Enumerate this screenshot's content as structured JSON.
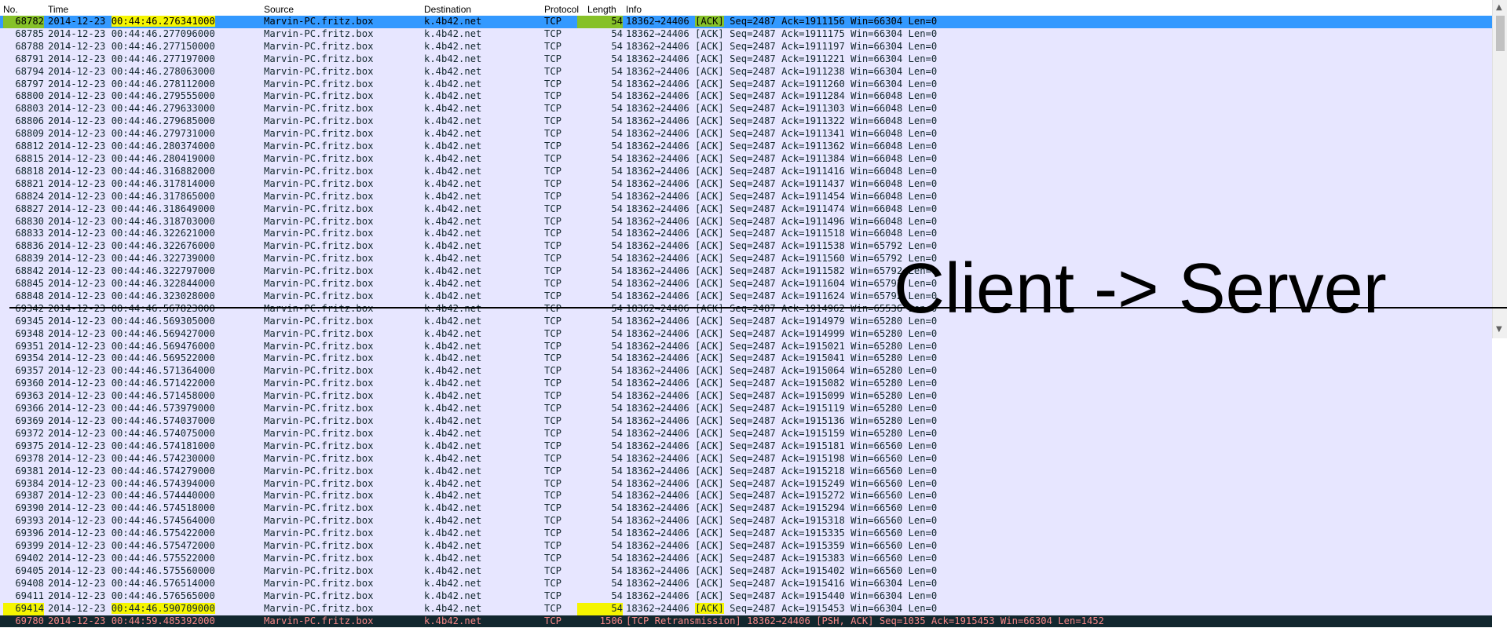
{
  "columns": {
    "no": "No.",
    "time": "Time",
    "source": "Source",
    "destination": "Destination",
    "protocol": "Protocol",
    "length": "Length",
    "info": "Info"
  },
  "annotation": "Client -> Server",
  "colors": {
    "row_bg": "#e7e6ff",
    "selected_bg": "#3399ff",
    "highlight_green": "#86c128",
    "highlight_yellow": "#f5f500",
    "retransmission_bg": "#12272e",
    "retransmission_fg": "#f78787"
  },
  "packets": [
    {
      "no": "68782",
      "time": "2014-12-23 00:44:46.276341000",
      "source": "Marvin-PC.fritz.box",
      "destination": "k.4b42.net",
      "protocol": "TCP",
      "length": "54",
      "info": "18362→24406 [ACK] Seq=2487 Ack=1911156 Win=66304 Len=0"
    },
    {
      "no": "68785",
      "time": "2014-12-23 00:44:46.277096000",
      "source": "Marvin-PC.fritz.box",
      "destination": "k.4b42.net",
      "protocol": "TCP",
      "length": "54",
      "info": "18362→24406 [ACK] Seq=2487 Ack=1911175 Win=66304 Len=0"
    },
    {
      "no": "68788",
      "time": "2014-12-23 00:44:46.277150000",
      "source": "Marvin-PC.fritz.box",
      "destination": "k.4b42.net",
      "protocol": "TCP",
      "length": "54",
      "info": "18362→24406 [ACK] Seq=2487 Ack=1911197 Win=66304 Len=0"
    },
    {
      "no": "68791",
      "time": "2014-12-23 00:44:46.277197000",
      "source": "Marvin-PC.fritz.box",
      "destination": "k.4b42.net",
      "protocol": "TCP",
      "length": "54",
      "info": "18362→24406 [ACK] Seq=2487 Ack=1911221 Win=66304 Len=0"
    },
    {
      "no": "68794",
      "time": "2014-12-23 00:44:46.278063000",
      "source": "Marvin-PC.fritz.box",
      "destination": "k.4b42.net",
      "protocol": "TCP",
      "length": "54",
      "info": "18362→24406 [ACK] Seq=2487 Ack=1911238 Win=66304 Len=0"
    },
    {
      "no": "68797",
      "time": "2014-12-23 00:44:46.278112000",
      "source": "Marvin-PC.fritz.box",
      "destination": "k.4b42.net",
      "protocol": "TCP",
      "length": "54",
      "info": "18362→24406 [ACK] Seq=2487 Ack=1911260 Win=66304 Len=0"
    },
    {
      "no": "68800",
      "time": "2014-12-23 00:44:46.279555000",
      "source": "Marvin-PC.fritz.box",
      "destination": "k.4b42.net",
      "protocol": "TCP",
      "length": "54",
      "info": "18362→24406 [ACK] Seq=2487 Ack=1911284 Win=66048 Len=0"
    },
    {
      "no": "68803",
      "time": "2014-12-23 00:44:46.279633000",
      "source": "Marvin-PC.fritz.box",
      "destination": "k.4b42.net",
      "protocol": "TCP",
      "length": "54",
      "info": "18362→24406 [ACK] Seq=2487 Ack=1911303 Win=66048 Len=0"
    },
    {
      "no": "68806",
      "time": "2014-12-23 00:44:46.279685000",
      "source": "Marvin-PC.fritz.box",
      "destination": "k.4b42.net",
      "protocol": "TCP",
      "length": "54",
      "info": "18362→24406 [ACK] Seq=2487 Ack=1911322 Win=66048 Len=0"
    },
    {
      "no": "68809",
      "time": "2014-12-23 00:44:46.279731000",
      "source": "Marvin-PC.fritz.box",
      "destination": "k.4b42.net",
      "protocol": "TCP",
      "length": "54",
      "info": "18362→24406 [ACK] Seq=2487 Ack=1911341 Win=66048 Len=0"
    },
    {
      "no": "68812",
      "time": "2014-12-23 00:44:46.280374000",
      "source": "Marvin-PC.fritz.box",
      "destination": "k.4b42.net",
      "protocol": "TCP",
      "length": "54",
      "info": "18362→24406 [ACK] Seq=2487 Ack=1911362 Win=66048 Len=0"
    },
    {
      "no": "68815",
      "time": "2014-12-23 00:44:46.280419000",
      "source": "Marvin-PC.fritz.box",
      "destination": "k.4b42.net",
      "protocol": "TCP",
      "length": "54",
      "info": "18362→24406 [ACK] Seq=2487 Ack=1911384 Win=66048 Len=0"
    },
    {
      "no": "68818",
      "time": "2014-12-23 00:44:46.316882000",
      "source": "Marvin-PC.fritz.box",
      "destination": "k.4b42.net",
      "protocol": "TCP",
      "length": "54",
      "info": "18362→24406 [ACK] Seq=2487 Ack=1911416 Win=66048 Len=0"
    },
    {
      "no": "68821",
      "time": "2014-12-23 00:44:46.317814000",
      "source": "Marvin-PC.fritz.box",
      "destination": "k.4b42.net",
      "protocol": "TCP",
      "length": "54",
      "info": "18362→24406 [ACK] Seq=2487 Ack=1911437 Win=66048 Len=0"
    },
    {
      "no": "68824",
      "time": "2014-12-23 00:44:46.317865000",
      "source": "Marvin-PC.fritz.box",
      "destination": "k.4b42.net",
      "protocol": "TCP",
      "length": "54",
      "info": "18362→24406 [ACK] Seq=2487 Ack=1911454 Win=66048 Len=0"
    },
    {
      "no": "68827",
      "time": "2014-12-23 00:44:46.318649000",
      "source": "Marvin-PC.fritz.box",
      "destination": "k.4b42.net",
      "protocol": "TCP",
      "length": "54",
      "info": "18362→24406 [ACK] Seq=2487 Ack=1911474 Win=66048 Len=0"
    },
    {
      "no": "68830",
      "time": "2014-12-23 00:44:46.318703000",
      "source": "Marvin-PC.fritz.box",
      "destination": "k.4b42.net",
      "protocol": "TCP",
      "length": "54",
      "info": "18362→24406 [ACK] Seq=2487 Ack=1911496 Win=66048 Len=0"
    },
    {
      "no": "68833",
      "time": "2014-12-23 00:44:46.322621000",
      "source": "Marvin-PC.fritz.box",
      "destination": "k.4b42.net",
      "protocol": "TCP",
      "length": "54",
      "info": "18362→24406 [ACK] Seq=2487 Ack=1911518 Win=66048 Len=0"
    },
    {
      "no": "68836",
      "time": "2014-12-23 00:44:46.322676000",
      "source": "Marvin-PC.fritz.box",
      "destination": "k.4b42.net",
      "protocol": "TCP",
      "length": "54",
      "info": "18362→24406 [ACK] Seq=2487 Ack=1911538 Win=65792 Len=0"
    },
    {
      "no": "68839",
      "time": "2014-12-23 00:44:46.322739000",
      "source": "Marvin-PC.fritz.box",
      "destination": "k.4b42.net",
      "protocol": "TCP",
      "length": "54",
      "info": "18362→24406 [ACK] Seq=2487 Ack=1911560 Win=65792 Len=0"
    },
    {
      "no": "68842",
      "time": "2014-12-23 00:44:46.322797000",
      "source": "Marvin-PC.fritz.box",
      "destination": "k.4b42.net",
      "protocol": "TCP",
      "length": "54",
      "info": "18362→24406 [ACK] Seq=2487 Ack=1911582 Win=65792 Len=0"
    },
    {
      "no": "68845",
      "time": "2014-12-23 00:44:46.322844000",
      "source": "Marvin-PC.fritz.box",
      "destination": "k.4b42.net",
      "protocol": "TCP",
      "length": "54",
      "info": "18362→24406 [ACK] Seq=2487 Ack=1911604 Win=65792 Len=0"
    },
    {
      "no": "68848",
      "time": "2014-12-23 00:44:46.323028000",
      "source": "Marvin-PC.fritz.box",
      "destination": "k.4b42.net",
      "protocol": "TCP",
      "length": "54",
      "info": "18362→24406 [ACK] Seq=2487 Ack=1911624 Win=65792 Len=0"
    },
    {
      "no": "69342",
      "time": "2014-12-23 00:44:46.567823000",
      "source": "Marvin-PC.fritz.box",
      "destination": "k.4b42.net",
      "protocol": "TCP",
      "length": "54",
      "info": "18362→24406 [ACK] Seq=2487 Ack=1914962 Win=65536 Len=0"
    },
    {
      "no": "69345",
      "time": "2014-12-23 00:44:46.569305000",
      "source": "Marvin-PC.fritz.box",
      "destination": "k.4b42.net",
      "protocol": "TCP",
      "length": "54",
      "info": "18362→24406 [ACK] Seq=2487 Ack=1914979 Win=65280 Len=0"
    },
    {
      "no": "69348",
      "time": "2014-12-23 00:44:46.569427000",
      "source": "Marvin-PC.fritz.box",
      "destination": "k.4b42.net",
      "protocol": "TCP",
      "length": "54",
      "info": "18362→24406 [ACK] Seq=2487 Ack=1914999 Win=65280 Len=0"
    },
    {
      "no": "69351",
      "time": "2014-12-23 00:44:46.569476000",
      "source": "Marvin-PC.fritz.box",
      "destination": "k.4b42.net",
      "protocol": "TCP",
      "length": "54",
      "info": "18362→24406 [ACK] Seq=2487 Ack=1915021 Win=65280 Len=0"
    },
    {
      "no": "69354",
      "time": "2014-12-23 00:44:46.569522000",
      "source": "Marvin-PC.fritz.box",
      "destination": "k.4b42.net",
      "protocol": "TCP",
      "length": "54",
      "info": "18362→24406 [ACK] Seq=2487 Ack=1915041 Win=65280 Len=0"
    },
    {
      "no": "69357",
      "time": "2014-12-23 00:44:46.571364000",
      "source": "Marvin-PC.fritz.box",
      "destination": "k.4b42.net",
      "protocol": "TCP",
      "length": "54",
      "info": "18362→24406 [ACK] Seq=2487 Ack=1915064 Win=65280 Len=0"
    },
    {
      "no": "69360",
      "time": "2014-12-23 00:44:46.571422000",
      "source": "Marvin-PC.fritz.box",
      "destination": "k.4b42.net",
      "protocol": "TCP",
      "length": "54",
      "info": "18362→24406 [ACK] Seq=2487 Ack=1915082 Win=65280 Len=0"
    },
    {
      "no": "69363",
      "time": "2014-12-23 00:44:46.571458000",
      "source": "Marvin-PC.fritz.box",
      "destination": "k.4b42.net",
      "protocol": "TCP",
      "length": "54",
      "info": "18362→24406 [ACK] Seq=2487 Ack=1915099 Win=65280 Len=0"
    },
    {
      "no": "69366",
      "time": "2014-12-23 00:44:46.573979000",
      "source": "Marvin-PC.fritz.box",
      "destination": "k.4b42.net",
      "protocol": "TCP",
      "length": "54",
      "info": "18362→24406 [ACK] Seq=2487 Ack=1915119 Win=65280 Len=0"
    },
    {
      "no": "69369",
      "time": "2014-12-23 00:44:46.574037000",
      "source": "Marvin-PC.fritz.box",
      "destination": "k.4b42.net",
      "protocol": "TCP",
      "length": "54",
      "info": "18362→24406 [ACK] Seq=2487 Ack=1915136 Win=65280 Len=0"
    },
    {
      "no": "69372",
      "time": "2014-12-23 00:44:46.574075000",
      "source": "Marvin-PC.fritz.box",
      "destination": "k.4b42.net",
      "protocol": "TCP",
      "length": "54",
      "info": "18362→24406 [ACK] Seq=2487 Ack=1915159 Win=65280 Len=0"
    },
    {
      "no": "69375",
      "time": "2014-12-23 00:44:46.574181000",
      "source": "Marvin-PC.fritz.box",
      "destination": "k.4b42.net",
      "protocol": "TCP",
      "length": "54",
      "info": "18362→24406 [ACK] Seq=2487 Ack=1915181 Win=66560 Len=0"
    },
    {
      "no": "69378",
      "time": "2014-12-23 00:44:46.574230000",
      "source": "Marvin-PC.fritz.box",
      "destination": "k.4b42.net",
      "protocol": "TCP",
      "length": "54",
      "info": "18362→24406 [ACK] Seq=2487 Ack=1915198 Win=66560 Len=0"
    },
    {
      "no": "69381",
      "time": "2014-12-23 00:44:46.574279000",
      "source": "Marvin-PC.fritz.box",
      "destination": "k.4b42.net",
      "protocol": "TCP",
      "length": "54",
      "info": "18362→24406 [ACK] Seq=2487 Ack=1915218 Win=66560 Len=0"
    },
    {
      "no": "69384",
      "time": "2014-12-23 00:44:46.574394000",
      "source": "Marvin-PC.fritz.box",
      "destination": "k.4b42.net",
      "protocol": "TCP",
      "length": "54",
      "info": "18362→24406 [ACK] Seq=2487 Ack=1915249 Win=66560 Len=0"
    },
    {
      "no": "69387",
      "time": "2014-12-23 00:44:46.574440000",
      "source": "Marvin-PC.fritz.box",
      "destination": "k.4b42.net",
      "protocol": "TCP",
      "length": "54",
      "info": "18362→24406 [ACK] Seq=2487 Ack=1915272 Win=66560 Len=0"
    },
    {
      "no": "69390",
      "time": "2014-12-23 00:44:46.574518000",
      "source": "Marvin-PC.fritz.box",
      "destination": "k.4b42.net",
      "protocol": "TCP",
      "length": "54",
      "info": "18362→24406 [ACK] Seq=2487 Ack=1915294 Win=66560 Len=0"
    },
    {
      "no": "69393",
      "time": "2014-12-23 00:44:46.574564000",
      "source": "Marvin-PC.fritz.box",
      "destination": "k.4b42.net",
      "protocol": "TCP",
      "length": "54",
      "info": "18362→24406 [ACK] Seq=2487 Ack=1915318 Win=66560 Len=0"
    },
    {
      "no": "69396",
      "time": "2014-12-23 00:44:46.575422000",
      "source": "Marvin-PC.fritz.box",
      "destination": "k.4b42.net",
      "protocol": "TCP",
      "length": "54",
      "info": "18362→24406 [ACK] Seq=2487 Ack=1915335 Win=66560 Len=0"
    },
    {
      "no": "69399",
      "time": "2014-12-23 00:44:46.575472000",
      "source": "Marvin-PC.fritz.box",
      "destination": "k.4b42.net",
      "protocol": "TCP",
      "length": "54",
      "info": "18362→24406 [ACK] Seq=2487 Ack=1915359 Win=66560 Len=0"
    },
    {
      "no": "69402",
      "time": "2014-12-23 00:44:46.575522000",
      "source": "Marvin-PC.fritz.box",
      "destination": "k.4b42.net",
      "protocol": "TCP",
      "length": "54",
      "info": "18362→24406 [ACK] Seq=2487 Ack=1915383 Win=66560 Len=0"
    },
    {
      "no": "69405",
      "time": "2014-12-23 00:44:46.575560000",
      "source": "Marvin-PC.fritz.box",
      "destination": "k.4b42.net",
      "protocol": "TCP",
      "length": "54",
      "info": "18362→24406 [ACK] Seq=2487 Ack=1915402 Win=66560 Len=0"
    },
    {
      "no": "69408",
      "time": "2014-12-23 00:44:46.576514000",
      "source": "Marvin-PC.fritz.box",
      "destination": "k.4b42.net",
      "protocol": "TCP",
      "length": "54",
      "info": "18362→24406 [ACK] Seq=2487 Ack=1915416 Win=66304 Len=0"
    },
    {
      "no": "69411",
      "time": "2014-12-23 00:44:46.576565000",
      "source": "Marvin-PC.fritz.box",
      "destination": "k.4b42.net",
      "protocol": "TCP",
      "length": "54",
      "info": "18362→24406 [ACK] Seq=2487 Ack=1915440 Win=66304 Len=0"
    },
    {
      "no": "69414",
      "time": "2014-12-23 00:44:46.590709000",
      "source": "Marvin-PC.fritz.box",
      "destination": "k.4b42.net",
      "protocol": "TCP",
      "length": "54",
      "info": "18362→24406 [ACK] Seq=2487 Ack=1915453 Win=66304 Len=0"
    },
    {
      "no": "69780",
      "time": "2014-12-23 00:44:59.485392000",
      "source": "Marvin-PC.fritz.box",
      "destination": "k.4b42.net",
      "protocol": "TCP",
      "length": "1506",
      "info": "[TCP Retransmission] 18362→24406 [PSH, ACK] Seq=1035 Ack=1915453 Win=66304 Len=1452"
    }
  ]
}
